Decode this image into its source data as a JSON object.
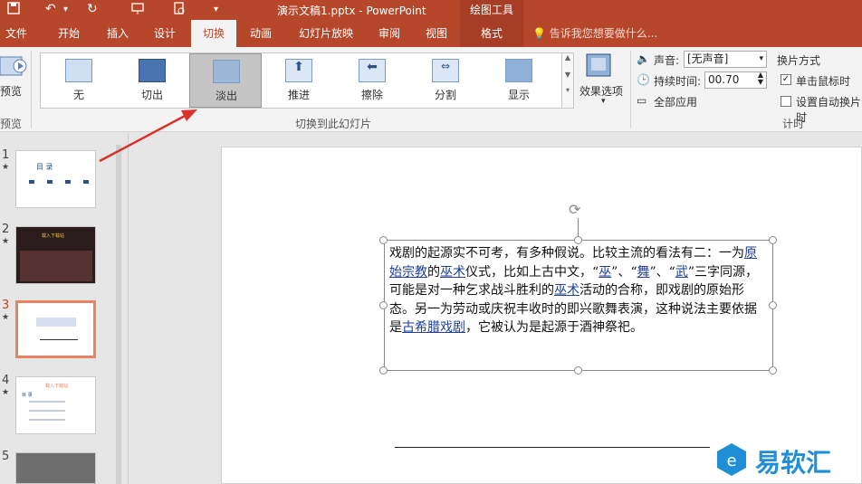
{
  "titlebar": {
    "title": "演示文稿1.pptx - PowerPoint",
    "context_group": "绘图工具",
    "save_icon": "save-icon",
    "undo_icon": "undo-icon",
    "redo_icon": "redo-icon"
  },
  "tabs": [
    "文件",
    "开始",
    "插入",
    "设计",
    "切换",
    "动画",
    "幻灯片放映",
    "审阅",
    "视图",
    "格式"
  ],
  "active_tab": "切换",
  "tell_me": "告诉我您想要做什么...",
  "ribbon": {
    "preview_label": "预览",
    "preview_group": "预览",
    "transitions": [
      "无",
      "切出",
      "淡出",
      "推进",
      "擦除",
      "分割",
      "显示"
    ],
    "selected_transition": "淡出",
    "transitions_group": "切换到此幻灯片",
    "effect_options": "效果选项",
    "sound_label": "声音:",
    "sound_value": "[无声音]",
    "duration_label": "持续时间:",
    "duration_value": "00.70",
    "apply_all": "全部应用",
    "advance_label": "换片方式",
    "on_click_label": "单击鼠标时",
    "on_click_checked": true,
    "auto_advance_label": "设置自动换片时",
    "auto_advance_checked": false,
    "timing_group": "计时"
  },
  "slides": {
    "numbers": [
      "1",
      "2",
      "3",
      "4",
      "5"
    ],
    "selected": "3",
    "thumb1_title": "目 录",
    "thumb2_title": "载入下载站",
    "thumb4_title": "载入下载站",
    "thumb4_sub": "目 录"
  },
  "slide_text": {
    "segments": [
      {
        "t": "戏剧的起源实不可考，有多种假说。比较主流的看法有二：一为",
        "link": false
      },
      {
        "t": "原始宗教",
        "link": true
      },
      {
        "t": "的",
        "link": false
      },
      {
        "t": "巫术",
        "link": true
      },
      {
        "t": "仪式，比如上古中文，“",
        "link": false
      },
      {
        "t": "巫",
        "link": true
      },
      {
        "t": "”、“",
        "link": false
      },
      {
        "t": "舞",
        "link": true
      },
      {
        "t": "”、“",
        "link": false
      },
      {
        "t": "武",
        "link": true
      },
      {
        "t": "”三字同源，可能是对一种乞求战斗胜利的",
        "link": false
      },
      {
        "t": "巫术",
        "link": true
      },
      {
        "t": "活动的合称，即戏剧的原始形态。另一为劳动或庆祝丰收时的即兴歌舞表演，这种说法主要依据是",
        "link": false
      },
      {
        "t": "古希腊戏剧",
        "link": true
      },
      {
        "t": "，它被认为是起源于酒神祭祀。",
        "link": false
      }
    ]
  },
  "watermark": "易软汇",
  "colors": {
    "accent": "#b7472a",
    "selected_thumb": "#e8825f",
    "link": "#1f3f9a"
  }
}
